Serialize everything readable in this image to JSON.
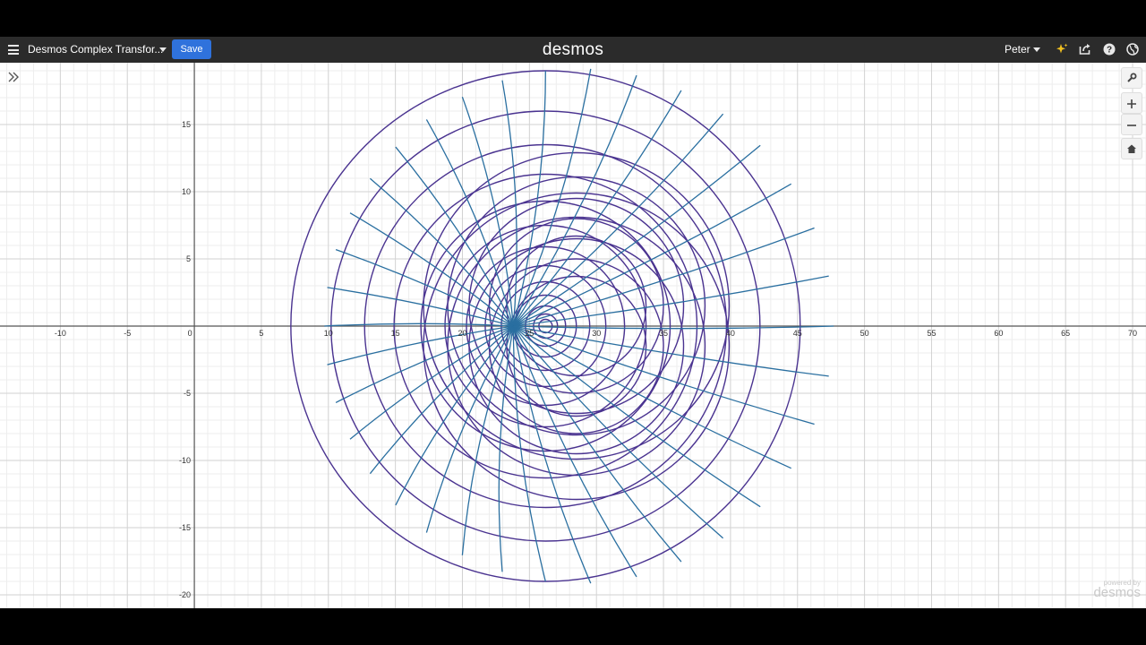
{
  "topbar": {
    "title": "Desmos Complex Transfor...",
    "save_label": "Save",
    "logo": "desmos",
    "user": "Peter"
  },
  "icons": {
    "menu": "hamburger-menu-icon",
    "title_dropdown": "chevron-down-icon",
    "user_dropdown": "chevron-down-icon",
    "sparkle": "sparkle-icon",
    "share": "share-icon",
    "help": "help-icon",
    "language": "globe-icon",
    "expand": "double-chevron-right-icon",
    "settings": "wrench-icon",
    "zoom_in": "plus-icon",
    "zoom_out": "minus-icon",
    "home": "home-icon"
  },
  "graph": {
    "x_ticks": [
      "-10",
      "-5",
      "0",
      "5",
      "10",
      "15",
      "20",
      "25",
      "30",
      "35",
      "40",
      "45",
      "50",
      "55",
      "60",
      "65",
      "70"
    ],
    "y_ticks": [
      "15",
      "10",
      "5",
      "-5",
      "-10",
      "-15",
      "-20"
    ],
    "xlim": [
      -14.5,
      71
    ],
    "ylim": [
      -21,
      19.6
    ],
    "curve_colors": {
      "circles": "#4a3390",
      "radials": "#2a6fa0"
    }
  },
  "watermark": {
    "small": "powered by",
    "big": "desmos"
  },
  "colors": {
    "topbar_bg": "#2b2b2b",
    "save_button": "#2f72dc",
    "sparkle": "#f0c020"
  }
}
